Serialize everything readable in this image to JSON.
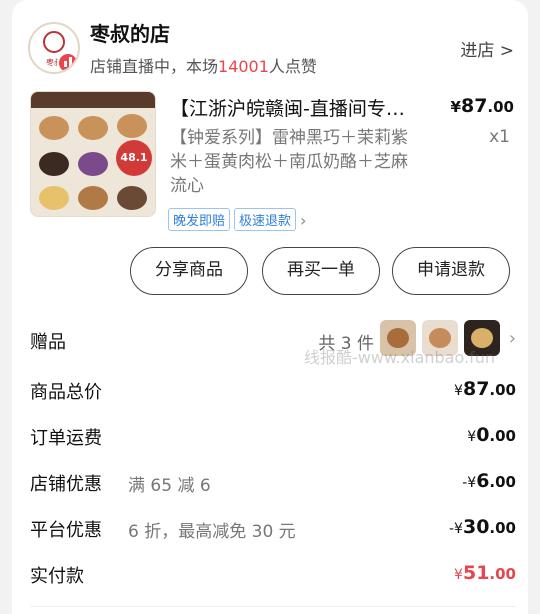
{
  "shop": {
    "logo_text": "枣叔",
    "name": "枣叔的店",
    "status_prefix": "店铺直播中，本场",
    "likes": "14001",
    "status_suffix": "人点赞",
    "enter_label": "进店 >"
  },
  "product": {
    "title": "【江浙沪皖赣闽-直播间专…",
    "price_symbol": "¥",
    "price_main": "87",
    "price_cents": ".00",
    "spec": "【钟爱系列】雷神黑巧＋茉莉紫米＋蛋黄肉松＋南瓜奶酪＋芝麻流心",
    "qty": "x1",
    "image_price_tag": "48.1",
    "tags": [
      "晚发即赔",
      "极速退款"
    ],
    "tags_more": "›"
  },
  "actions": {
    "share": "分享商品",
    "rebuy": "再买一单",
    "refund": "申请退款"
  },
  "gift": {
    "label": "赠品",
    "count": "共 3 件",
    "more": "›",
    "watermark": "线报酷-www.xianbao.fun"
  },
  "summary": {
    "total_label": "商品总价",
    "total_sym": "¥",
    "total_main": "87",
    "total_cents": ".00",
    "shipping_label": "订单运费",
    "shipping_sym": "¥",
    "shipping_main": "0",
    "shipping_cents": ".00",
    "shop_discount_label": "店铺优惠",
    "shop_discount_desc": "满 65 减 6",
    "shop_discount_sym": "-¥",
    "shop_discount_main": "6",
    "shop_discount_cents": ".00",
    "platform_discount_label": "平台优惠",
    "platform_discount_desc": "6 折，最高减免 30 元",
    "platform_discount_sym": "-¥",
    "platform_discount_main": "30",
    "platform_discount_cents": ".00",
    "paid_label": "实付款",
    "paid_sym": "¥",
    "paid_main": "51",
    "paid_cents": ".00"
  },
  "colors": {
    "accent_red": "#e8454c",
    "tag_blue": "#2f7fd8"
  }
}
